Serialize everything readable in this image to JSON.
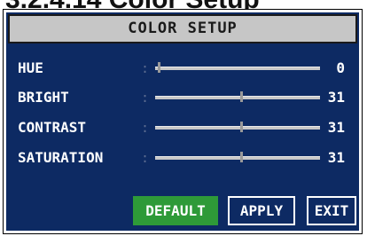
{
  "section_heading": "3.2.4.14 Color Setup",
  "dialog": {
    "title": "COLOR SETUP",
    "colon": ":",
    "rows": [
      {
        "label": "HUE",
        "value": "0",
        "level": 0.02
      },
      {
        "label": "BRIGHT",
        "value": "31",
        "level": 0.52
      },
      {
        "label": "CONTRAST",
        "value": "31",
        "level": 0.52
      },
      {
        "label": "SATURATION",
        "value": "31",
        "level": 0.52
      }
    ],
    "buttons": {
      "default_label": "DEFAULT",
      "apply_label": "APPLY",
      "exit_label": "EXIT"
    }
  },
  "colors": {
    "dialog_background": "#0d2a63",
    "title_background": "#c6c6c6",
    "selected_button": "#2e9a38",
    "text": "#ffffff"
  }
}
